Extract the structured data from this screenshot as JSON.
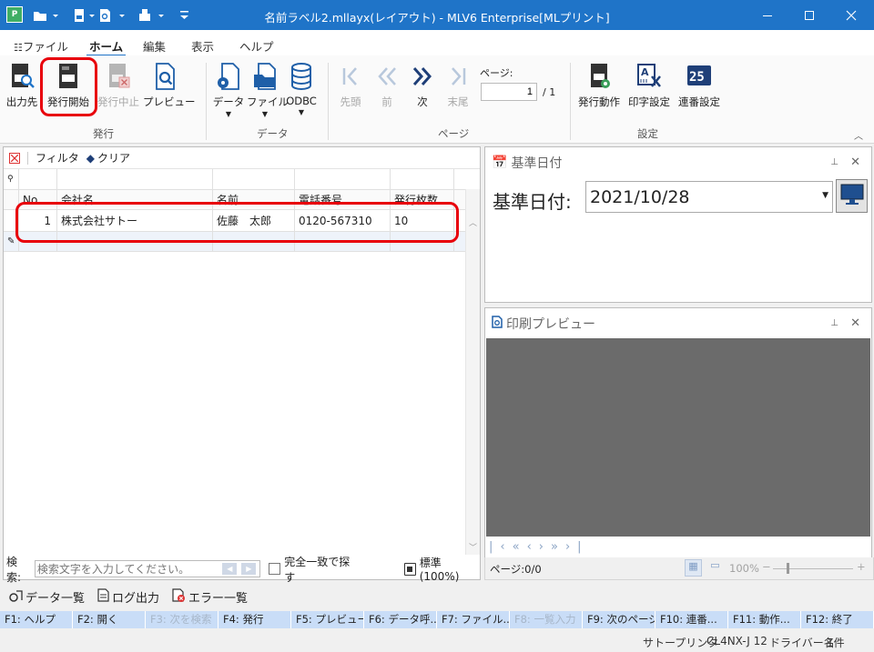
{
  "window": {
    "title": "名前ラベル2.mllayx(レイアウト) - MLV6 Enterprise[MLプリント]"
  },
  "menu": [
    "ファイル",
    "ホーム",
    "編集",
    "表示",
    "ヘルプ"
  ],
  "ribbon": {
    "buttons": {
      "output": "出力先",
      "start": "発行開始",
      "stop": "発行中止",
      "preview": "プレビュー",
      "data": "データ",
      "file": "ファイル",
      "odbc": "ODBC",
      "first": "先頭",
      "prev": "前",
      "next": "次",
      "last": "末尾",
      "action": "発行動作",
      "print_settings": "印字設定",
      "serial": "連番設定"
    },
    "groups": {
      "issue": "発行",
      "data": "データ",
      "page": "ページ",
      "settings": "設定"
    },
    "page": {
      "label": "ページ:",
      "current": "1",
      "total": "/ 1"
    }
  },
  "filter": {
    "filter_label": "フィルタ",
    "clear_label": "クリア"
  },
  "table": {
    "columns": [
      "No.",
      "会社名",
      "名前",
      "電話番号",
      "発行枚数"
    ],
    "rows": [
      [
        "1",
        "株式会社サトー",
        "佐藤　太郎",
        "0120-567310",
        "10"
      ]
    ]
  },
  "search": {
    "label": "検索:",
    "placeholder": "検索文字を入力してください。",
    "exact": "完全一致で探す",
    "zoom": "標準(100%)"
  },
  "base_date": {
    "title": "基準日付",
    "label": "基準日付:",
    "value": "2021/10/28"
  },
  "print_preview": {
    "title": "印刷プレビュー",
    "page": "ページ:0/0",
    "zoom": "100%"
  },
  "bottom_tools": {
    "data_list": "データ一覧",
    "log_output": "ログ出力",
    "error_list": "エラー一覧"
  },
  "fkeys": [
    "F1: ヘルプ",
    "F2: 開く",
    "F3: 次を検索",
    "F4: 発行",
    "F5: プレビュー",
    "F6: データ呼...",
    "F7: ファイル...",
    "F8: 一覧入力",
    "F9: 次のページ",
    "F10: 連番...",
    "F11: 動作...",
    "F12: 終了"
  ],
  "status": {
    "printer_label": "サトープリンタ",
    "printer_model": "CL4NX-J 12",
    "driver": "ドライバー名",
    "count": "1件"
  },
  "colors": {
    "titlebar": "#1f74c8",
    "highlight": "#e8000b",
    "fkey": "#c9ddf7",
    "preview_bg": "#6b6b6b"
  }
}
